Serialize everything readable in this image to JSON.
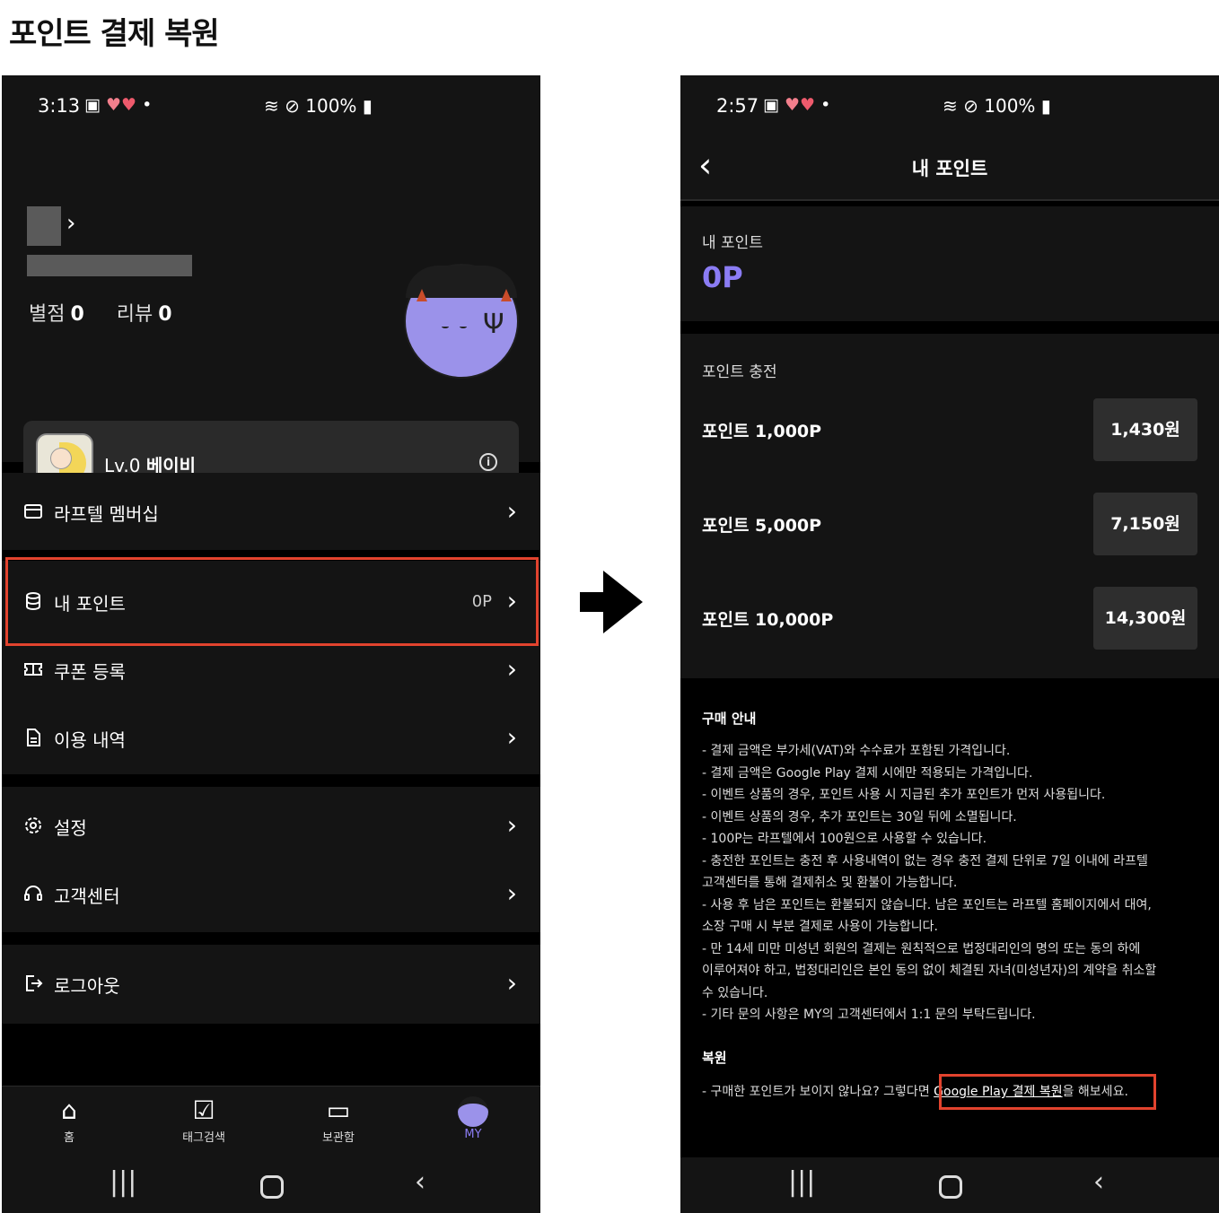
{
  "page_title": "포인트 결제 복원",
  "status_left": {
    "time": "3:13",
    "battery": "100%"
  },
  "status_right": {
    "time": "2:57",
    "battery": "100%"
  },
  "profile": {
    "stars_label": "별점",
    "stars_count": "0",
    "reviews_label": "리뷰",
    "reviews_count": "0",
    "level_prefix": "Lv.0",
    "level_name": "베이비"
  },
  "menu": {
    "membership": "라프텔 멤버십",
    "my_points": "내 포인트",
    "my_points_value": "0P",
    "coupon": "쿠폰 등록",
    "history": "이용 내역",
    "settings": "설정",
    "support": "고객센터",
    "logout": "로그아웃"
  },
  "bottom_nav": {
    "home": "홈",
    "tag_search": "태그검색",
    "storage": "보관함",
    "my": "MY"
  },
  "icons": {
    "membership": "card-icon",
    "points": "coin-stack-icon",
    "coupon": "ticket-icon",
    "history": "document-icon",
    "settings": "gear-icon",
    "support": "headset-icon",
    "logout": "logout-icon"
  },
  "colors": {
    "accent": "#8b7cf4",
    "highlight": "#e2432e"
  },
  "points_screen": {
    "title": "내 포인트",
    "points_label": "내 포인트",
    "points_value": "0P",
    "charge_title": "포인트 충전",
    "packages": [
      {
        "name": "포인트 1,000P",
        "price": "1,430원"
      },
      {
        "name": "포인트 5,000P",
        "price": "7,150원"
      },
      {
        "name": "포인트 10,000P",
        "price": "14,300원"
      }
    ],
    "notice_title": "구매 안내",
    "notice_lines": [
      "- 결제 금액은 부가세(VAT)와 수수료가 포함된 가격입니다.",
      "- 결제 금액은 Google Play 결제 시에만 적용되는 가격입니다.",
      "- 이벤트 상품의 경우, 포인트 사용 시 지급된 추가 포인트가 먼저 사용됩니다.",
      "- 이벤트 상품의 경우, 추가 포인트는 30일 뒤에 소멸됩니다.",
      "- 100P는 라프텔에서 100원으로 사용할 수 있습니다.",
      "- 충전한 포인트는 충전 후 사용내역이 없는 경우 충전 결제 단위로 7일 이내에 라프텔",
      "고객센터를 통해 결제취소 및 환불이 가능합니다.",
      "- 사용 후 남은 포인트는 환불되지 않습니다. 남은 포인트는 라프텔 홈페이지에서 대여,",
      "소장 구매 시 부분 결제로 사용이 가능합니다.",
      "- 만 14세 미만 미성년 회원의 결제는 원칙적으로 법정대리인의 명의 또는 동의 하에",
      "이루어져야 하고, 법정대리인은 본인 동의 없이 체결된 자녀(미성년자)의 계약을 취소할",
      "수 있습니다.",
      "- 기타 문의 사항은 MY의 고객센터에서 1:1 문의 부탁드립니다."
    ],
    "restore_title": "복원",
    "restore_prefix": "- 구매한 포인트가 보이지 않나요? 그렇다면 ",
    "restore_link": "Google Play 결제 복원",
    "restore_suffix": "을 해보세요."
  }
}
